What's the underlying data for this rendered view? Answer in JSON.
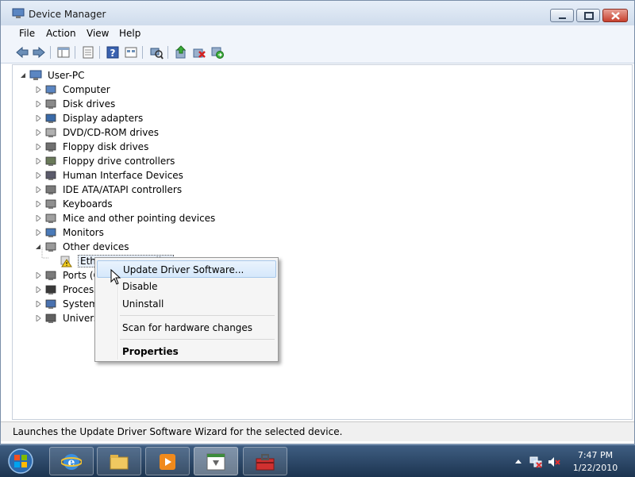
{
  "window": {
    "title": "Device Manager"
  },
  "menu": [
    "File",
    "Action",
    "View",
    "Help"
  ],
  "toolbar_icons": [
    "back-icon",
    "forward-icon",
    "show-hide-console-tree-icon",
    "properties-icon",
    "help-icon",
    "view-icon",
    "scan-hardware-changes-icon",
    "update-driver-icon",
    "uninstall-icon",
    "enable-device-icon"
  ],
  "tree": {
    "root": "User-PC",
    "nodes": [
      {
        "label": "Computer",
        "icon": "computer-icon",
        "expanded": false
      },
      {
        "label": "Disk drives",
        "icon": "disk-drive-icon",
        "expanded": false
      },
      {
        "label": "Display adapters",
        "icon": "display-adapter-icon",
        "expanded": false
      },
      {
        "label": "DVD/CD-ROM drives",
        "icon": "dvd-drive-icon",
        "expanded": false
      },
      {
        "label": "Floppy disk drives",
        "icon": "floppy-disk-icon",
        "expanded": false
      },
      {
        "label": "Floppy drive controllers",
        "icon": "floppy-controller-icon",
        "expanded": false
      },
      {
        "label": "Human Interface Devices",
        "icon": "hid-icon",
        "expanded": false
      },
      {
        "label": "IDE ATA/ATAPI controllers",
        "icon": "ide-controller-icon",
        "expanded": false
      },
      {
        "label": "Keyboards",
        "icon": "keyboard-icon",
        "expanded": false
      },
      {
        "label": "Mice and other pointing devices",
        "icon": "mouse-icon",
        "expanded": false
      },
      {
        "label": "Monitors",
        "icon": "monitor-icon",
        "expanded": false
      },
      {
        "label": "Other devices",
        "icon": "unknown-device-icon",
        "expanded": true
      },
      {
        "label": "Ethernet Controller",
        "icon": "warning-device-icon",
        "child": true,
        "selected": true
      },
      {
        "label": "Ports (COM & LPT)",
        "icon": "port-icon",
        "expanded": false
      },
      {
        "label": "Processors",
        "icon": "processor-icon",
        "expanded": false
      },
      {
        "label": "System devices",
        "icon": "system-device-icon",
        "expanded": false
      },
      {
        "label": "Universal Serial Bus controllers",
        "icon": "usb-icon",
        "expanded": false
      }
    ]
  },
  "context_menu": {
    "update_driver": "Update Driver Software...",
    "disable": "Disable",
    "uninstall": "Uninstall",
    "scan": "Scan for hardware changes",
    "properties": "Properties"
  },
  "status": {
    "text": "Launches the Update Driver Software Wizard for the selected device."
  },
  "taskbar": {
    "apps": [
      "internet-explorer-icon",
      "windows-explorer-icon",
      "media-player-icon",
      "device-manager-icon",
      "toolbox-icon"
    ],
    "time": "7:47 PM",
    "date": "1/22/2010"
  },
  "colors": {
    "titlebar": "#dbe6f3",
    "highlight": "#d6e8fb",
    "taskbar": "#2a4668"
  }
}
